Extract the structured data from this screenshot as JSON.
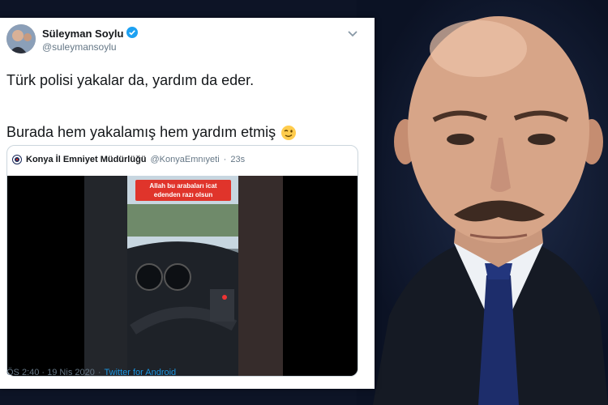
{
  "tweet": {
    "author": "Süleyman Soylu",
    "handle": "@suleymansoylu",
    "text_line1": "Türk polisi yakalar da, yardım da eder.",
    "text_line2": "Burada hem yakalamış hem yardım etmiş",
    "timestamp": "ÖS 2:40 · 19 Nis 2020",
    "separator": "·",
    "source": "Twitter for Android",
    "verified_color": "#1da1f2",
    "emoji_icon": "winking-face-icon"
  },
  "quoted_tweet": {
    "author": "Konya İl Emniyet Müdürlüğü",
    "handle": "@KonyaEmnıyeti",
    "time": "23s",
    "video_caption": "Allah bu arabaları icat edenden razı olsun",
    "video_caption_color": "#e0342b"
  },
  "colors": {
    "background": "#0d1426",
    "card": "#ffffff",
    "text": "#14171a",
    "muted": "#657786",
    "link": "#1b95e0"
  }
}
